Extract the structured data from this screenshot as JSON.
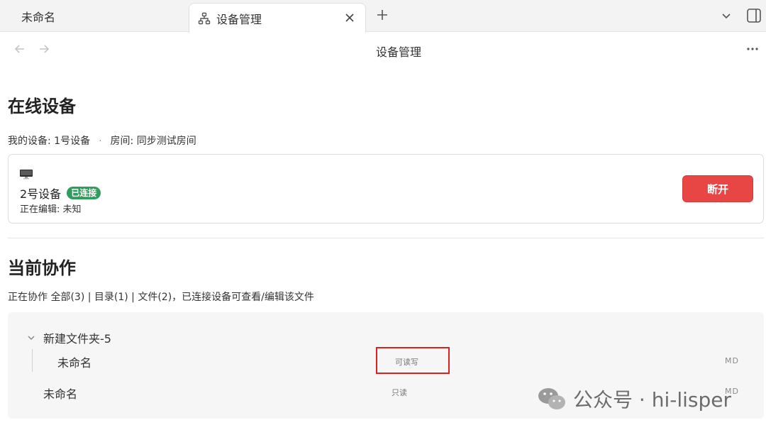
{
  "tabs": [
    {
      "label": "未命名",
      "active": false
    },
    {
      "label": "设备管理",
      "active": true
    }
  ],
  "nav": {
    "title": "设备管理"
  },
  "online_section": {
    "heading": "在线设备",
    "my_device": "我的设备: 1号设备",
    "separator": "·",
    "room": "房间: 同步测试房间"
  },
  "device": {
    "icon": "monitor-icon",
    "name": "2号设备",
    "status_badge": "已连接",
    "status_color": "#2f9e5c",
    "editing": "正在编辑: 未知",
    "disconnect_label": "断开",
    "disconnect_color": "#e84545"
  },
  "collab_section": {
    "heading": "当前协作",
    "summary": "正在协作 全部(3) | 目录(1) | 文件(2)，已连接设备可查看/编辑该文件"
  },
  "files": {
    "folder": {
      "name": "新建文件夹-5",
      "expanded": true
    },
    "items": [
      {
        "name": "未命名",
        "permission": "可读写",
        "ext": "MD",
        "in_folder": true
      },
      {
        "name": "未命名",
        "permission": "只读",
        "ext": "MD",
        "in_folder": false
      }
    ]
  },
  "watermark": {
    "text": "公众号 · hi-lisper"
  }
}
